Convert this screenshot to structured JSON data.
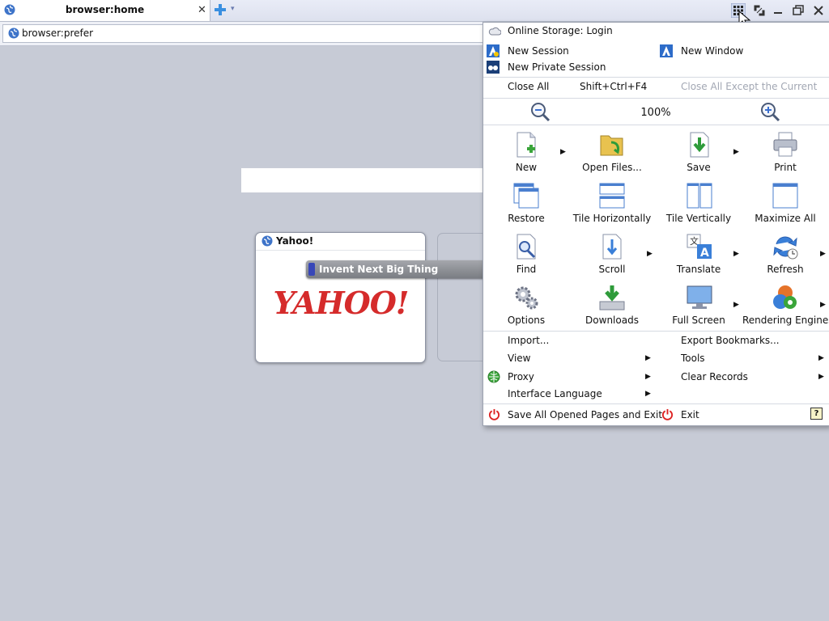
{
  "tabs": [
    {
      "title": "browser:home"
    }
  ],
  "address_bar": {
    "value": "browser:prefer"
  },
  "speed_dial": {
    "cards": [
      {
        "title": "Yahoo!",
        "logo_text": "YAHOO!"
      }
    ],
    "tooltip": "Invent Next Big Thing"
  },
  "menu": {
    "online_storage": "Online Storage: Login",
    "new_session": "New Session",
    "new_window": "New Window",
    "new_private_session": "New Private Session",
    "close_all": "Close All",
    "close_all_shortcut": "Shift+Ctrl+F4",
    "close_all_except": "Close All Except the Current",
    "zoom_level": "100%",
    "grid": [
      "New",
      "Open Files...",
      "Save",
      "Print",
      "Restore",
      "Tile Horizontally",
      "Tile Vertically",
      "Maximize All",
      "Find",
      "Scroll",
      "Translate",
      "Refresh",
      "Options",
      "Downloads",
      "Full Screen",
      "Rendering Engines"
    ],
    "import": "Import...",
    "export_bookmarks": "Export Bookmarks...",
    "view": "View",
    "tools": "Tools",
    "proxy": "Proxy",
    "clear_records": "Clear Records",
    "interface_language": "Interface Language",
    "save_all_exit": "Save All Opened Pages and Exit",
    "exit": "Exit",
    "help": "?"
  }
}
